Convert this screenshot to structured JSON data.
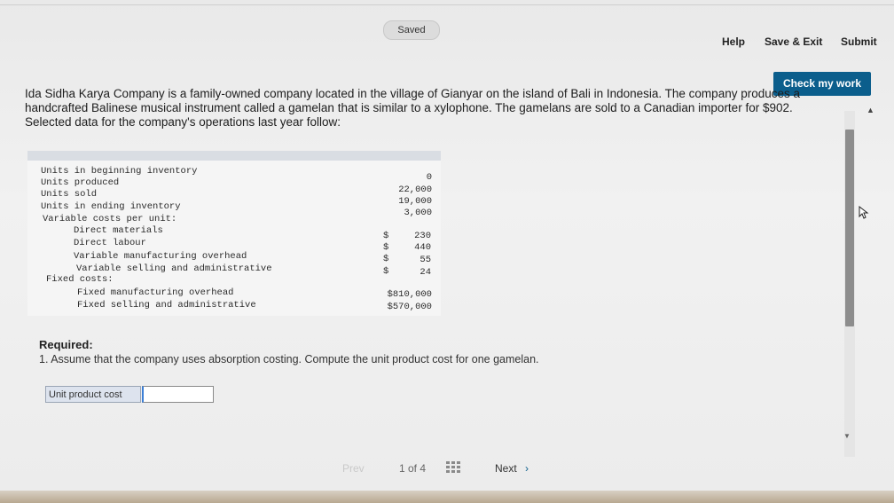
{
  "header": {
    "saved_label": "Saved",
    "help_label": "Help",
    "save_exit_label": "Save & Exit",
    "submit_label": "Submit",
    "check_work_label": "Check my work"
  },
  "problem": {
    "intro": "Ida Sidha Karya Company is a family-owned company located in the village of Gianyar on the island of Bali in Indonesia. The company produces a handcrafted Balinese musical instrument called a gamelan that is similar to a xylophone. The gamelans are sold to a Canadian importer for $902. Selected data for the company's operations last year follow:"
  },
  "data_table": {
    "rows": [
      {
        "label": "Units in beginning inventory",
        "currency": "",
        "value": "0"
      },
      {
        "label": "Units produced",
        "currency": "",
        "value": "22,000"
      },
      {
        "label": "Units sold",
        "currency": "",
        "value": "19,000"
      },
      {
        "label": "Units in ending inventory",
        "currency": "",
        "value": "3,000"
      },
      {
        "label": "Variable costs per unit:",
        "currency": "",
        "value": ""
      },
      {
        "label": "Direct materials",
        "currency": "$",
        "value": "230"
      },
      {
        "label": "Direct labour",
        "currency": "$",
        "value": "440"
      },
      {
        "label": "Variable manufacturing overhead",
        "currency": "$",
        "value": "55"
      },
      {
        "label": "Variable selling and administrative",
        "currency": "$",
        "value": "24"
      },
      {
        "label": "Fixed costs:",
        "currency": "",
        "value": ""
      },
      {
        "label": "Fixed manufacturing overhead",
        "currency": "",
        "value": "$810,000"
      },
      {
        "label": "Fixed selling and administrative",
        "currency": "",
        "value": "$570,000"
      }
    ]
  },
  "required": {
    "title": "Required:",
    "text": "1. Assume that the company uses absorption costing. Compute the unit product cost for one gamelan."
  },
  "answer": {
    "label": "Unit product cost",
    "value": ""
  },
  "pagination": {
    "prev_label": "Prev",
    "page_text": "1 of 4",
    "next_label": "Next",
    "next_chevron": "›"
  }
}
